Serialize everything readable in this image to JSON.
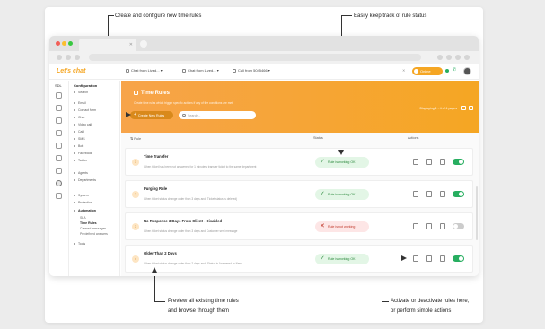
{
  "annotations": {
    "top_left": "Create and configure new time rules",
    "top_right": "Easily keep track of rule status",
    "bottom_left_line1": "Preview all existing time rules",
    "bottom_left_line2": "and browse through them",
    "bottom_right_line1": "Activate or deactivate rules here,",
    "bottom_right_line2": "or perform simple actions"
  },
  "browser": {
    "tab_title": "",
    "url": ""
  },
  "appbar": {
    "logo": "Let's chat",
    "tabs": [
      {
        "label": "Chat from Lived..."
      },
      {
        "label": "Chat from Lived..."
      },
      {
        "label": "Call from 5045466"
      }
    ],
    "online_label": "Online"
  },
  "rail": {
    "top_label": "SDL"
  },
  "settings_nav": {
    "heading": "Configuration",
    "items": [
      {
        "label": "Search"
      },
      {
        "label": "Email"
      },
      {
        "label": "Contact form"
      },
      {
        "label": "Chat"
      },
      {
        "label": "Video call"
      },
      {
        "label": "Call"
      },
      {
        "label": "SMS"
      },
      {
        "label": "Bot"
      },
      {
        "label": "Facebook"
      },
      {
        "label": "Twitter"
      },
      {
        "label": "Agents"
      },
      {
        "label": "Departments"
      },
      {
        "label": "System"
      },
      {
        "label": "Protection"
      },
      {
        "label": "Automation"
      }
    ],
    "sub_items": [
      {
        "label": "SLA"
      },
      {
        "label": "Time Rules"
      },
      {
        "label": "Canned messages"
      },
      {
        "label": "Predefined answers"
      }
    ],
    "tools": "Tools"
  },
  "hero": {
    "title": "Time Rules",
    "description": "Create time rules which trigger specific actions if any of the conditions are met.",
    "create_label": "Create New Rules",
    "search_placeholder": "Search...",
    "display_info": "Displaying 1 - 4 of 4 pages"
  },
  "table": {
    "col_rule": "Rule",
    "col_status": "Status",
    "col_actions": "Actions",
    "rows": [
      {
        "num": "1",
        "title": "Time Transfer",
        "desc": "When ticket has been not answered for 1 minutes, transfer ticket to the same department",
        "status": "Rule is working OK",
        "state": "ok",
        "enabled": true
      },
      {
        "num": "2",
        "title": "Purging Rule",
        "desc": "When ticket status change older than 3 days and (Ticket status is deleted)",
        "status": "Rule is working OK",
        "state": "ok",
        "enabled": true
      },
      {
        "num": "3",
        "title": "No Response 3 Days From Client - Disabled",
        "desc": "When ticket status change older than 3 days and Customer sent message",
        "status": "Rule is not working",
        "state": "bad",
        "enabled": false
      },
      {
        "num": "4",
        "title": "Older Than 2 Days",
        "desc": "When ticket status change older than 2 days and (Status is Answered or New)",
        "status": "Rule is working OK",
        "state": "ok",
        "enabled": true
      }
    ]
  }
}
